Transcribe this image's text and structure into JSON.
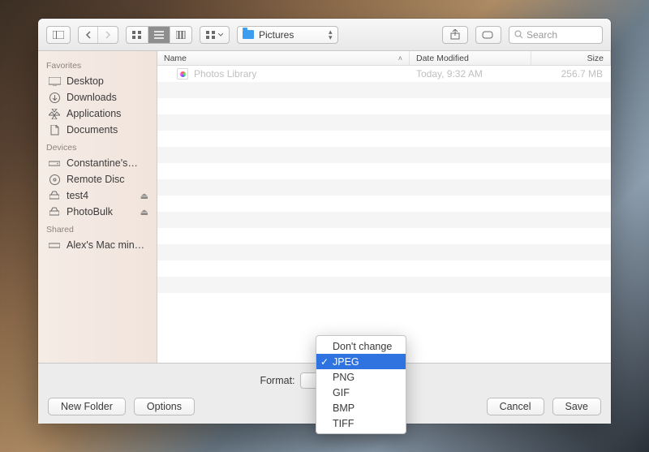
{
  "toolbar": {
    "location_label": "Pictures",
    "search_placeholder": "Search"
  },
  "sidebar": {
    "sections": [
      {
        "title": "Favorites",
        "items": [
          {
            "icon": "desktop-icon",
            "label": "Desktop"
          },
          {
            "icon": "downloads-icon",
            "label": "Downloads"
          },
          {
            "icon": "applications-icon",
            "label": "Applications"
          },
          {
            "icon": "documents-icon",
            "label": "Documents"
          }
        ]
      },
      {
        "title": "Devices",
        "items": [
          {
            "icon": "disk-icon",
            "label": "Constantine's…"
          },
          {
            "icon": "remote-disc-icon",
            "label": "Remote Disc"
          },
          {
            "icon": "volume-icon",
            "label": "test4",
            "eject": true
          },
          {
            "icon": "volume-icon",
            "label": "PhotoBulk",
            "eject": true
          }
        ]
      },
      {
        "title": "Shared",
        "items": [
          {
            "icon": "shared-mac-icon",
            "label": "Alex's Mac min…"
          }
        ]
      }
    ]
  },
  "file_list": {
    "columns": {
      "name": "Name",
      "date": "Date Modified",
      "size": "Size"
    },
    "rows": [
      {
        "name": "Photos Library",
        "date": "Today, 9:32 AM",
        "size": "256.7 MB"
      }
    ]
  },
  "format_panel": {
    "label": "Format:",
    "selected": "JPEG",
    "options": [
      "Don't change",
      "JPEG",
      "PNG",
      "GIF",
      "BMP",
      "TIFF"
    ]
  },
  "buttons": {
    "new_folder": "New Folder",
    "options": "Options",
    "cancel": "Cancel",
    "save": "Save"
  }
}
